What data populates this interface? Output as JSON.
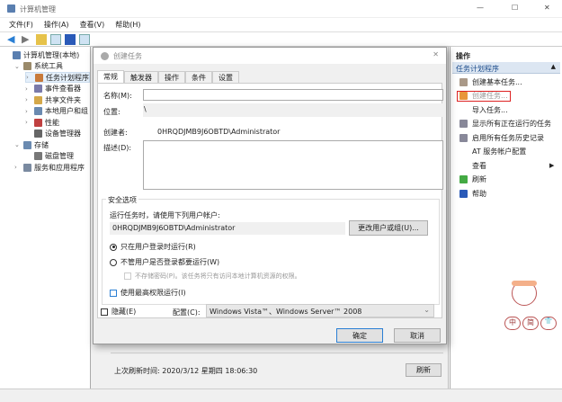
{
  "window": {
    "title": "计算机管理",
    "min": "—",
    "max": "☐",
    "close": "✕"
  },
  "menu": [
    "文件(F)",
    "操作(A)",
    "查看(V)",
    "帮助(H)"
  ],
  "tree": [
    {
      "label": "计算机管理(本地)",
      "indent": 0,
      "chev": ""
    },
    {
      "label": "系统工具",
      "indent": 1,
      "chev": "⌄"
    },
    {
      "label": "任务计划程序",
      "indent": 2,
      "chev": "›",
      "selected": true
    },
    {
      "label": "事件查看器",
      "indent": 2,
      "chev": "›"
    },
    {
      "label": "共享文件夹",
      "indent": 2,
      "chev": "›"
    },
    {
      "label": "本地用户和组",
      "indent": 2,
      "chev": "›"
    },
    {
      "label": "性能",
      "indent": 2,
      "chev": "›"
    },
    {
      "label": "设备管理器",
      "indent": 2,
      "chev": ""
    },
    {
      "label": "存储",
      "indent": 1,
      "chev": "⌄"
    },
    {
      "label": "磁盘管理",
      "indent": 2,
      "chev": ""
    },
    {
      "label": "服务和应用程序",
      "indent": 1,
      "chev": "›"
    }
  ],
  "actions": {
    "header": "操作",
    "section": "任务计划程序",
    "items": [
      "创建基本任务...",
      "创建任务...",
      "导入任务...",
      "显示所有正在运行的任务",
      "启用所有任务历史记录",
      "AT 服务帐户配置",
      "查看",
      "刷新",
      "帮助"
    ]
  },
  "ime": {
    "chars": [
      "中",
      "简",
      "👕"
    ]
  },
  "background": {
    "last_refresh": "上次刷新时间: 2020/3/12 星期四 18:06:30",
    "refresh": "刷新"
  },
  "dialog": {
    "title": "创建任务",
    "tabs": [
      "常规",
      "触发器",
      "操作",
      "条件",
      "设置"
    ],
    "name_label": "名称(M):",
    "name_value": "",
    "location_label": "位置:",
    "location_value": "\\",
    "author_label": "创建者:",
    "author_value": "0HRQDJMB9J6OBTD\\Administrator",
    "desc_label": "描述(D):",
    "security_title": "安全选项",
    "run_as_label": "运行任务时，请使用下列用户帐户:",
    "run_as_value": "0HRQDJMB9J6OBTD\\Administrator",
    "change_user": "更改用户或组(U)...",
    "radio_logged_on": "只在用户登录时运行(R)",
    "radio_any": "不管用户是否登录都要运行(W)",
    "no_store_pw": "不存储密码(P)。该任务将只有访问本地计算机资源的权限。",
    "highest": "使用最高权限运行(I)",
    "hidden": "隐藏(E)",
    "config_label": "配置(C):",
    "config_value": "Windows Vista™、Windows Server™ 2008",
    "ok": "确定",
    "cancel": "取消"
  }
}
